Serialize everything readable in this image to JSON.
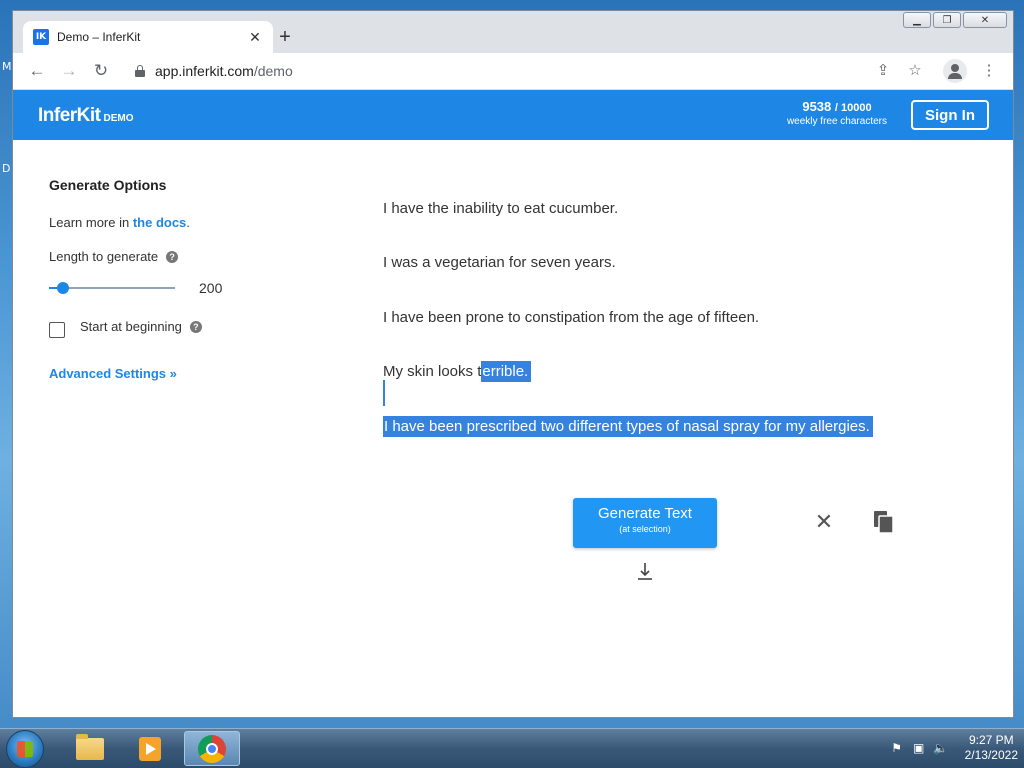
{
  "desktop": {
    "letter_top": "M",
    "letter_mid": "D"
  },
  "browser": {
    "tab_title": "Demo – InferKit",
    "favicon_text": "IK",
    "url_host": "app.inferkit.com",
    "url_path": "/demo"
  },
  "app": {
    "logo": "InferKit",
    "logo_suffix": "DEMO",
    "credits_used": "9538",
    "credits_total": "/ 10000",
    "credits_label": "weekly free characters",
    "sign_in": "Sign In",
    "brand_color": "#1e87e5"
  },
  "sidebar": {
    "title": "Generate Options",
    "learn_prefix": "Learn more in ",
    "docs_link": "the docs",
    "learn_suffix": ".",
    "length_label": "Length to generate",
    "length_value": "200",
    "length_fraction": 0.11,
    "start_label": "Start at beginning",
    "start_checked": false,
    "advanced": "Advanced Settings »"
  },
  "editor": {
    "line1": "I have the inability to eat cucumber.",
    "line2": "I was a vegetarian for seven years.",
    "line3": "I have been prone to constipation from the age of fifteen.",
    "line4_plain": "My skin looks t",
    "line4_selected": "errible.",
    "line5_selected": "I have been prescribed two different types of nasal spray for my allergies."
  },
  "actions": {
    "generate_label": "Generate Text",
    "generate_sub": "(at selection)"
  },
  "taskbar": {
    "time": "9:27 PM",
    "date": "2/13/2022"
  }
}
